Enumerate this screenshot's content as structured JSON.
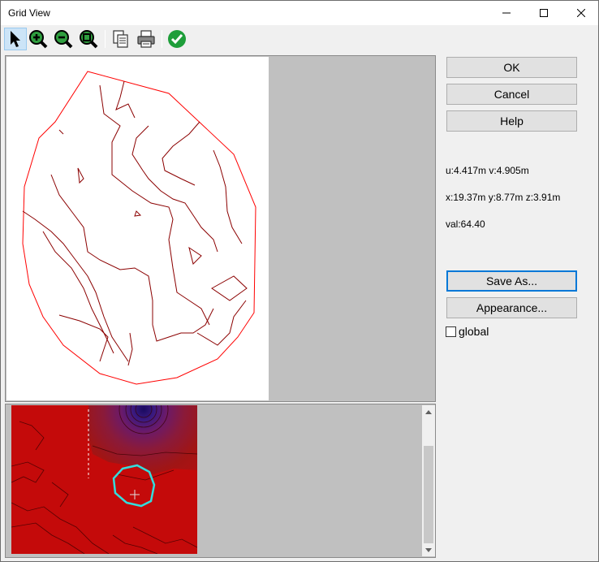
{
  "window": {
    "title": "Grid View"
  },
  "toolbar": {
    "tools": [
      {
        "name": "select-arrow-icon",
        "active": true
      },
      {
        "name": "zoom-in-icon"
      },
      {
        "name": "zoom-out-icon"
      },
      {
        "name": "zoom-fit-icon"
      },
      {
        "name": "copy-icon"
      },
      {
        "name": "print-icon"
      },
      {
        "name": "apply-checkmark-icon"
      }
    ]
  },
  "buttons": {
    "ok": "OK",
    "cancel": "Cancel",
    "help": "Help",
    "save_as": "Save As...",
    "appearance": "Appearance..."
  },
  "readouts": {
    "uv": "u:4.417m v:4.905m",
    "xyz": "x:19.37m y:8.77m z:3.91m",
    "val": "val:64.40"
  },
  "options": {
    "global_label": "global",
    "global_checked": false
  },
  "colors": {
    "boundary": "#ff0000",
    "contour": "#8b0000",
    "heatmap_base": "#c00000",
    "highlight_contour": "#33dddd",
    "focus": "#0078d7"
  }
}
